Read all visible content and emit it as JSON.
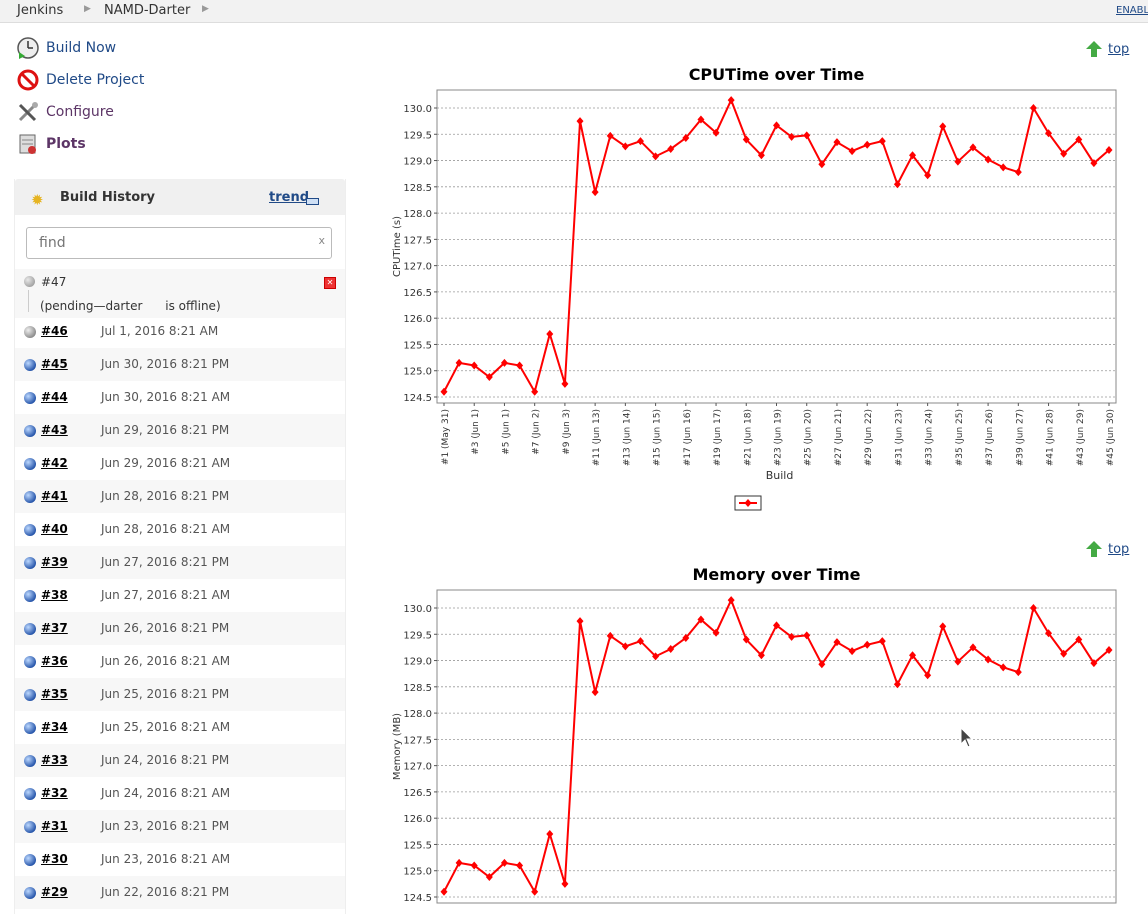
{
  "breadcrumbs": [
    "Jenkins",
    "NAMD-Darter"
  ],
  "enable_link": "ENABLE AUTO REFRESH",
  "tasks": [
    {
      "label": "Build Now",
      "icon": "clock-play-icon"
    },
    {
      "label": "Delete Project",
      "icon": "no-entry-icon"
    },
    {
      "label": "Configure",
      "icon": "wrench-screwdriver-icon"
    },
    {
      "label": "Plots",
      "icon": "plot-icon"
    }
  ],
  "build_history": {
    "title": "Build History",
    "trend_label": "trend",
    "search_placeholder": "find",
    "search_clear": "x",
    "pending": {
      "number": "#47",
      "text": "(pending—darter      is offline)"
    },
    "builds": [
      {
        "number": "#46",
        "date": "Jul 1, 2016 8:21 AM",
        "status": "grey"
      },
      {
        "number": "#45",
        "date": "Jun 30, 2016 8:21 PM",
        "status": "blue"
      },
      {
        "number": "#44",
        "date": "Jun 30, 2016 8:21 AM",
        "status": "blue"
      },
      {
        "number": "#43",
        "date": "Jun 29, 2016 8:21 PM",
        "status": "blue"
      },
      {
        "number": "#42",
        "date": "Jun 29, 2016 8:21 AM",
        "status": "blue"
      },
      {
        "number": "#41",
        "date": "Jun 28, 2016 8:21 PM",
        "status": "blue"
      },
      {
        "number": "#40",
        "date": "Jun 28, 2016 8:21 AM",
        "status": "blue"
      },
      {
        "number": "#39",
        "date": "Jun 27, 2016 8:21 PM",
        "status": "blue"
      },
      {
        "number": "#38",
        "date": "Jun 27, 2016 8:21 AM",
        "status": "blue"
      },
      {
        "number": "#37",
        "date": "Jun 26, 2016 8:21 PM",
        "status": "blue"
      },
      {
        "number": "#36",
        "date": "Jun 26, 2016 8:21 AM",
        "status": "blue"
      },
      {
        "number": "#35",
        "date": "Jun 25, 2016 8:21 PM",
        "status": "blue"
      },
      {
        "number": "#34",
        "date": "Jun 25, 2016 8:21 AM",
        "status": "blue"
      },
      {
        "number": "#33",
        "date": "Jun 24, 2016 8:21 PM",
        "status": "blue"
      },
      {
        "number": "#32",
        "date": "Jun 24, 2016 8:21 AM",
        "status": "blue"
      },
      {
        "number": "#31",
        "date": "Jun 23, 2016 8:21 PM",
        "status": "blue"
      },
      {
        "number": "#30",
        "date": "Jun 23, 2016 8:21 AM",
        "status": "blue"
      },
      {
        "number": "#29",
        "date": "Jun 22, 2016 8:21 PM",
        "status": "blue"
      }
    ]
  },
  "top_link": "top",
  "colors": {
    "series": "#ff0000",
    "link": "#204a87",
    "grid": "#999999"
  },
  "chart_data": [
    {
      "type": "line",
      "title": "CPUTime over Time",
      "xlabel": "Build",
      "ylabel": "CPUTime (s)",
      "ylim": [
        124.5,
        130.0
      ],
      "yticks": [
        "124.5",
        "125.0",
        "125.5",
        "126.0",
        "126.5",
        "127.0",
        "127.5",
        "128.0",
        "128.5",
        "129.0",
        "129.5",
        "130.0"
      ],
      "x_tick_labels": [
        "#1 (May 31)",
        "#3 (Jun 1)",
        "#5 (Jun 1)",
        "#7 (Jun 2)",
        "#9 (Jun 3)",
        "#11 (Jun 13)",
        "#13 (Jun 14)",
        "#15 (Jun 15)",
        "#17 (Jun 16)",
        "#19 (Jun 17)",
        "#21 (Jun 18)",
        "#23 (Jun 19)",
        "#25 (Jun 20)",
        "#27 (Jun 21)",
        "#29 (Jun 22)",
        "#31 (Jun 23)",
        "#33 (Jun 24)",
        "#35 (Jun 25)",
        "#37 (Jun 26)",
        "#39 (Jun 27)",
        "#41 (Jun 28)",
        "#43 (Jun 29)",
        "#45 (Jun 30)"
      ],
      "grid": true,
      "legend": "bottom-center",
      "series": [
        {
          "values": [
            124.6,
            125.15,
            125.1,
            124.88,
            125.15,
            125.1,
            124.6,
            125.7,
            124.75,
            129.75,
            128.4,
            129.47,
            129.27,
            129.37,
            129.08,
            129.22,
            129.43,
            129.78,
            129.53,
            130.15,
            129.4,
            129.1,
            129.67,
            129.45,
            129.48,
            128.93,
            129.35,
            129.18,
            129.3,
            129.37,
            128.55,
            129.1,
            128.72,
            129.65,
            128.98,
            129.25,
            129.02,
            128.87,
            128.78,
            130.0,
            129.52,
            129.13,
            129.4,
            128.95,
            129.2
          ]
        }
      ]
    },
    {
      "type": "line",
      "title": "Memory over Time",
      "ylabel": "Memory (MB)",
      "ylim": [
        124.5,
        130.0
      ],
      "yticks": [
        "124.5",
        "125.0",
        "125.5",
        "126.0",
        "126.5",
        "127.0",
        "127.5",
        "128.0",
        "128.5",
        "129.0",
        "129.5",
        "130.0"
      ],
      "grid": true,
      "series": [
        {
          "values": [
            124.6,
            125.15,
            125.1,
            124.88,
            125.15,
            125.1,
            124.6,
            125.7,
            124.75,
            129.75,
            128.4,
            129.47,
            129.27,
            129.37,
            129.08,
            129.22,
            129.43,
            129.78,
            129.53,
            130.15,
            129.4,
            129.1,
            129.67,
            129.45,
            129.48,
            128.93,
            129.35,
            129.18,
            129.3,
            129.37,
            128.55,
            129.1,
            128.72,
            129.65,
            128.98,
            129.25,
            129.02,
            128.87,
            128.78,
            130.0,
            129.52,
            129.13,
            129.4,
            128.95,
            129.2
          ]
        }
      ]
    }
  ]
}
